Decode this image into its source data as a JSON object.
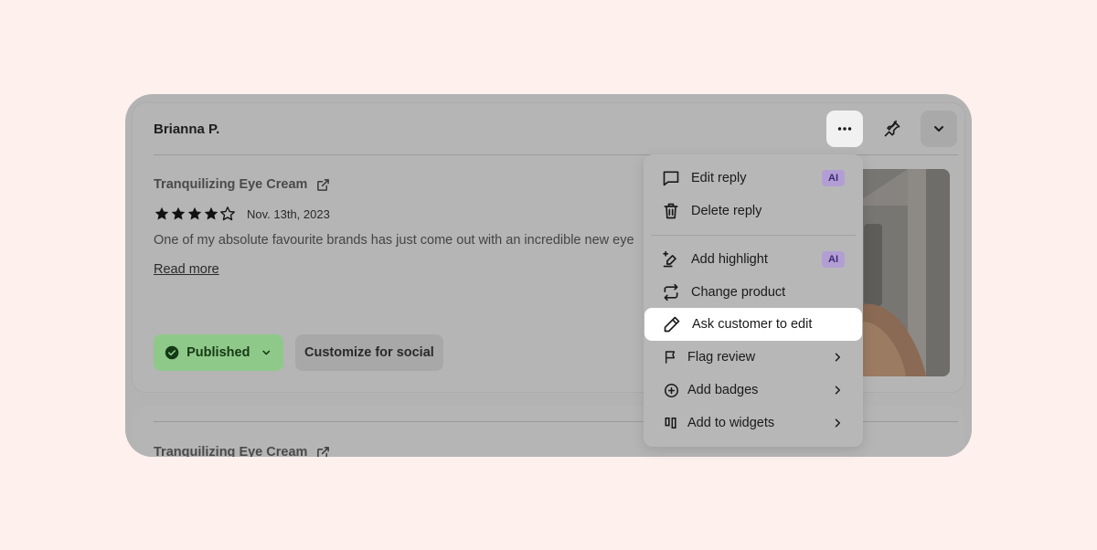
{
  "review": {
    "reviewer_name": "Brianna P.",
    "product_name": "Tranquilizing Eye Cream",
    "rating": 4,
    "rating_max": 5,
    "date": "Nov. 13th, 2023",
    "body_excerpt": "One of my absolute favourite brands has just come out with an incredible new eye",
    "read_more_label": "Read more",
    "status_label": "Published",
    "customize_label": "Customize for social"
  },
  "review2": {
    "product_name": "Tranquilizing Eye Cream"
  },
  "toolbar": {
    "more_icon": "more-horizontal-icon",
    "pin_icon": "pin-icon",
    "collapse_icon": "chevron-down-icon"
  },
  "menu": {
    "items": [
      {
        "label": "Edit reply",
        "icon": "message-square-icon",
        "badge": "AI"
      },
      {
        "label": "Delete reply",
        "icon": "trash-icon"
      },
      {
        "label": "Add highlight",
        "icon": "highlighter-icon",
        "badge": "AI"
      },
      {
        "label": "Change product",
        "icon": "swap-icon"
      },
      {
        "label": "Ask customer to edit",
        "icon": "pencil-icon"
      },
      {
        "label": "Flag review",
        "icon": "flag-icon",
        "submenu": true
      },
      {
        "label": "Add badges",
        "icon": "plus-circle-icon",
        "submenu": true
      },
      {
        "label": "Add to widgets",
        "icon": "widgets-icon",
        "submenu": true
      }
    ]
  },
  "colors": {
    "page_background": "#fef0ec",
    "overlay": "#b3b3b3",
    "published_green": "#8fc98a",
    "ai_badge": "#b39ed4"
  }
}
